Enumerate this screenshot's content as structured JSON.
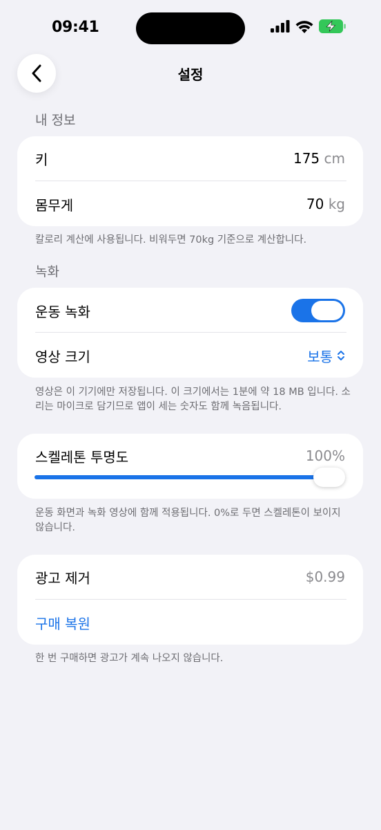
{
  "status_bar": {
    "time": "09:41"
  },
  "nav": {
    "title": "설정"
  },
  "profile": {
    "header": "내 정보",
    "height_label": "키",
    "height_value": "175",
    "height_unit": "cm",
    "weight_label": "몸무게",
    "weight_value": "70",
    "weight_unit": "kg",
    "footer": "칼로리 계산에 사용됩니다. 비워두면 70kg 기준으로 계산합니다."
  },
  "recording": {
    "header": "녹화",
    "toggle_label": "운동 녹화",
    "toggle_on": true,
    "size_label": "영상 크기",
    "size_value": "보통",
    "footer": "영상은 이 기기에만 저장됩니다. 이 크기에서는 1분에 약 18 MB 입니다. 소리는 마이크로 담기므로 앱이 세는 숫자도 함께 녹음됩니다."
  },
  "skeleton": {
    "label": "스켈레톤 투명도",
    "value_text": "100%",
    "value": 1.0,
    "footer": "운동 화면과 녹화 영상에 함께 적용됩니다. 0%로 두면 스켈레톤이 보이지 않습니다."
  },
  "purchase": {
    "remove_ads_label": "광고 제거",
    "price": "$0.99",
    "restore_label": "구매 복원",
    "footer": "한 번 구매하면 광고가 계속 나오지 않습니다."
  },
  "colors": {
    "accent": "#1a73e8",
    "background": "#f2f2f7",
    "battery": "#34c759"
  }
}
